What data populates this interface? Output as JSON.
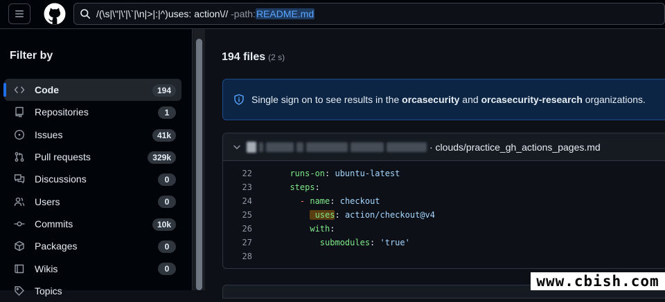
{
  "header": {
    "search_query_main": "/(\\s|\\\"|\\'|\\`|\\n|>|:|^)uses: action\\//",
    "search_qualifier": " -path:",
    "search_qualifier_value": "README.md"
  },
  "sidebar": {
    "title": "Filter by",
    "items": [
      {
        "label": "Code",
        "count": "194",
        "icon": "code-icon",
        "selected": true
      },
      {
        "label": "Repositories",
        "count": "1",
        "icon": "repo-icon"
      },
      {
        "label": "Issues",
        "count": "41k",
        "icon": "issue-icon"
      },
      {
        "label": "Pull requests",
        "count": "329k",
        "icon": "pull-request-icon"
      },
      {
        "label": "Discussions",
        "count": "0",
        "icon": "discussion-icon"
      },
      {
        "label": "Users",
        "count": "0",
        "icon": "users-icon"
      },
      {
        "label": "Commits",
        "count": "10k",
        "icon": "commit-icon"
      },
      {
        "label": "Packages",
        "count": "0",
        "icon": "package-icon"
      },
      {
        "label": "Wikis",
        "count": "0",
        "icon": "book-icon"
      },
      {
        "label": "Topics",
        "count": "",
        "icon": "topic-icon"
      }
    ]
  },
  "results": {
    "count": "194 files",
    "time": "(2 s)"
  },
  "sso_banner": {
    "prefix": "Single sign on to see results in the ",
    "org1": "orcasecurity",
    "middle": " and ",
    "org2": "orcasecurity-research",
    "suffix": " organizations."
  },
  "result": {
    "file_path": "· clouds/practice_gh_actions_pages.md",
    "lines": [
      {
        "n": "22",
        "indent": "  ",
        "key": "runs-on",
        "sep": ": ",
        "val": "ubuntu-latest"
      },
      {
        "n": "23",
        "indent": "  ",
        "key": "steps",
        "sep": ":",
        "val": ""
      },
      {
        "n": "24",
        "indent": "    ",
        "dash": "- ",
        "key": "name",
        "sep": ": ",
        "val": "checkout"
      },
      {
        "n": "25",
        "indent": "      ",
        "key": "uses",
        "sep": ": ",
        "val": "action/checkout@v4",
        "highlight": true
      },
      {
        "n": "26",
        "indent": "      ",
        "key": "with",
        "sep": ":",
        "val": ""
      },
      {
        "n": "27",
        "indent": "        ",
        "key": "submodules",
        "sep": ": ",
        "val": "'true'"
      },
      {
        "n": "28",
        "indent": "",
        "key": "",
        "sep": "",
        "val": ""
      }
    ]
  },
  "watermark": "www.cbish.com",
  "colors": {
    "accent": "#1f6feb",
    "link": "#58a6ff",
    "yaml_key": "#7ee787",
    "yaml_value": "#a5d6ff",
    "match_highlight": "#5a3e12"
  }
}
